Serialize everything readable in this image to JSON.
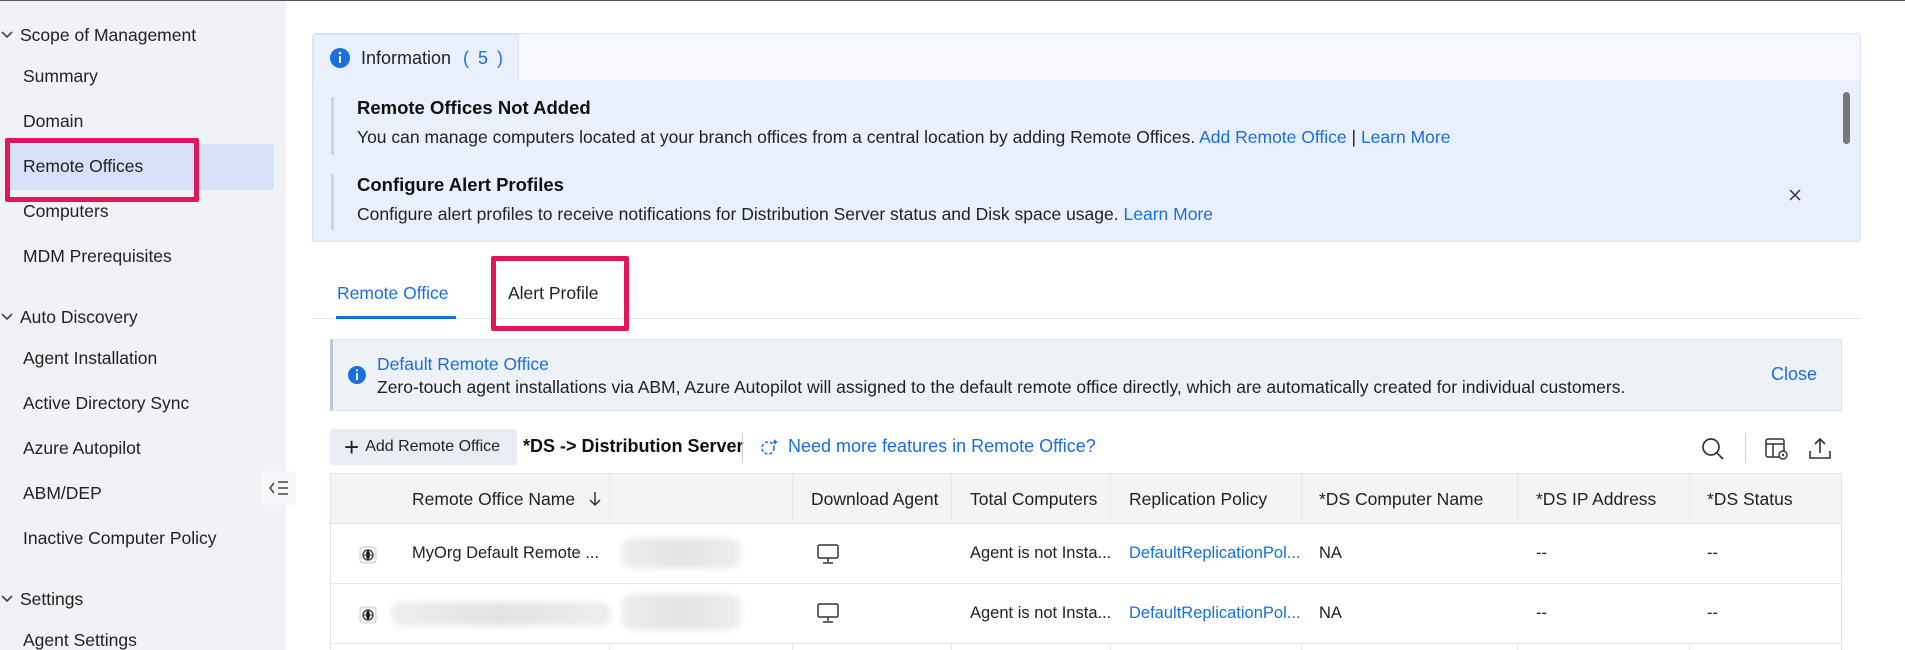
{
  "sidebar": {
    "sections": [
      {
        "label": "Scope of Management",
        "items": [
          "Summary",
          "Domain",
          "Remote Offices",
          "Computers",
          "MDM Prerequisites"
        ]
      },
      {
        "label": "Auto Discovery",
        "items": [
          "Agent Installation",
          "Active Directory Sync",
          "Azure Autopilot",
          "ABM/DEP",
          "Inactive Computer Policy"
        ]
      },
      {
        "label": "Settings",
        "items": [
          "Agent Settings"
        ]
      }
    ],
    "active_item": "Remote Offices"
  },
  "info": {
    "tab_label": "Information",
    "count": "( 5 )",
    "items": [
      {
        "title": "Remote Offices Not Added",
        "desc": "You can manage computers located at your branch offices from a central location by adding Remote Offices.",
        "link1": "Add Remote Office",
        "divider": "|",
        "link2": "Learn More"
      },
      {
        "title": "Configure Alert Profiles",
        "desc": "Configure alert profiles to receive notifications for Distribution Server status and Disk space usage.",
        "link1": "Learn More"
      }
    ]
  },
  "tabs": [
    {
      "label": "Remote Office",
      "active": true
    },
    {
      "label": "Alert Profile",
      "active": false
    }
  ],
  "banner": {
    "title": "Default Remote Office",
    "desc": "Zero-touch agent installations via ABM, Azure Autopilot will assigned to the default remote office directly, which are automatically created for individual customers.",
    "close": "Close"
  },
  "toolbar": {
    "add_label": "Add Remote Office",
    "ds_note": "*DS -> Distribution Server",
    "features_link": "Need more features in Remote Office?"
  },
  "table": {
    "columns": [
      "Remote Office Name",
      "Download Agent",
      "Total Computers",
      "Replication Policy",
      "*DS Computer Name",
      "*DS IP Address",
      "*DS Status"
    ],
    "rows": [
      {
        "name": "MyOrg Default Remote ...",
        "total": "Agent is not Insta...",
        "policy": "DefaultReplicationPol...",
        "ds_name": "NA",
        "ds_ip": "--",
        "ds_status": "--"
      },
      {
        "name": "",
        "total": "Agent is not Insta...",
        "policy": "DefaultReplicationPol...",
        "ds_name": "NA",
        "ds_ip": "--",
        "ds_status": "--"
      }
    ]
  },
  "colors": {
    "accent": "#1a6fe0",
    "highlight": "#e3155b",
    "active_bg": "#d6e0f7"
  }
}
